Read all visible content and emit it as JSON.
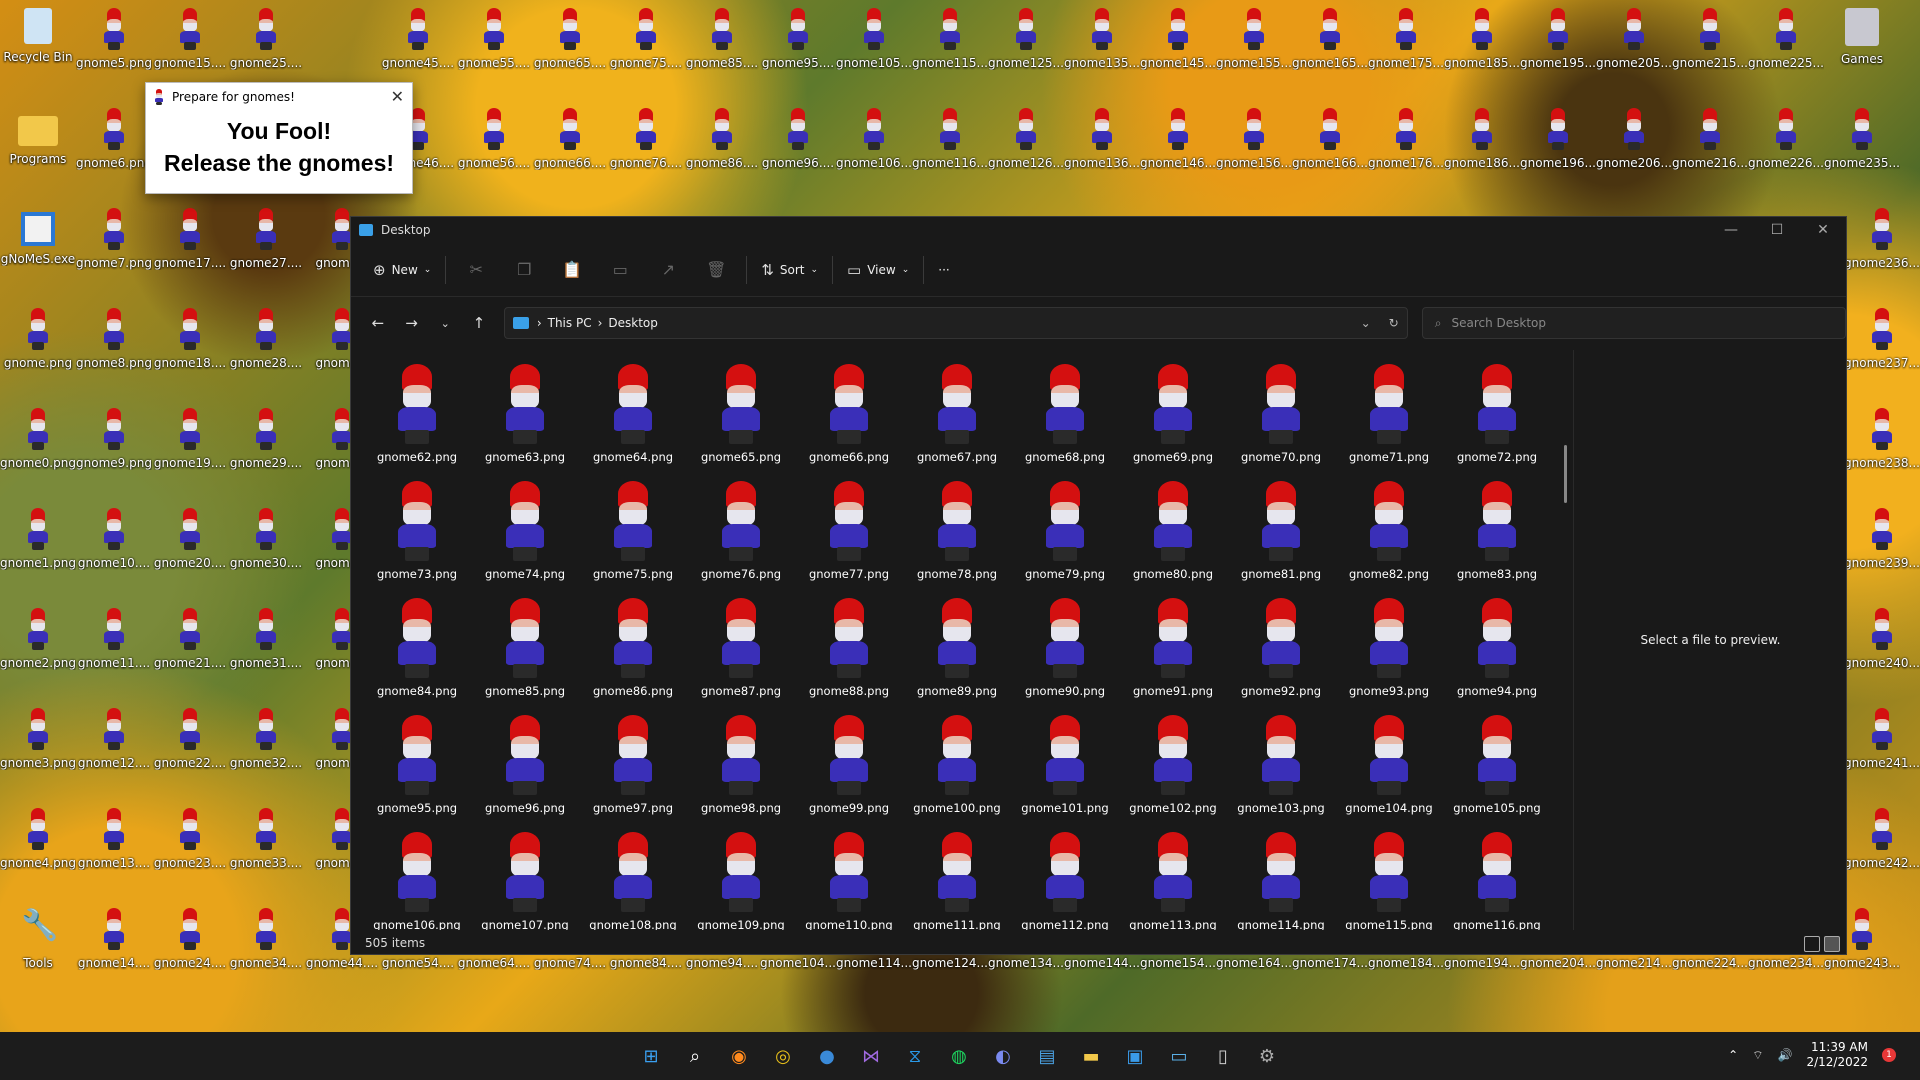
{
  "desktop": {
    "col0": [
      "Recycle Bin",
      "Programs",
      "gNoMeS.exe",
      "gnome.png",
      "gnome0.png",
      "gnome1.png",
      "gnome2.png",
      "gnome3.png",
      "gnome4.png",
      "Tools"
    ],
    "col1": [
      "gnome5.png",
      "gnome6.png",
      "gnome7.png",
      "gnome8.png",
      "gnome9.png",
      "gnome10....",
      "gnome11....",
      "gnome12....",
      "gnome13....",
      "gnome14...."
    ],
    "col2": [
      "gnome15....",
      "",
      "gnome17....",
      "gnome18....",
      "gnome19....",
      "gnome20....",
      "gnome21....",
      "gnome22....",
      "gnome23....",
      "gnome24...."
    ],
    "col3": [
      "gnome25....",
      "",
      "gnome27....",
      "gnome28....",
      "gnome29....",
      "gnome30....",
      "gnome31....",
      "gnome32....",
      "gnome33....",
      "gnome34...."
    ],
    "col4": [
      "gnome35....",
      "",
      "gnome...",
      "gnome...",
      "gnome...",
      "gnome...",
      "gnome...",
      "gnome...",
      "gnome...",
      "gnome44...."
    ],
    "row0": [
      "gnome45....",
      "gnome55....",
      "gnome65....",
      "gnome75....",
      "gnome85....",
      "gnome95....",
      "gnome105....",
      "gnome115....",
      "gnome125....",
      "gnome135....",
      "gnome145....",
      "gnome155....",
      "gnome165....",
      "gnome175....",
      "gnome185....",
      "gnome195....",
      "gnome205....",
      "gnome215....",
      "gnome225....",
      "Games"
    ],
    "row1": [
      "gnome46....",
      "gnome56....",
      "gnome66....",
      "gnome76....",
      "gnome86....",
      "gnome96....",
      "gnome106....",
      "gnome116....",
      "gnome126....",
      "gnome136....",
      "gnome146....",
      "gnome156....",
      "gnome166....",
      "gnome176....",
      "gnome186....",
      "gnome196....",
      "gnome206....",
      "gnome216....",
      "gnome226....",
      "gnome235...."
    ],
    "bottom": [
      "gnome54....",
      "gnome64....",
      "gnome74....",
      "gnome84....",
      "gnome94....",
      "gnome104....",
      "gnome114....",
      "gnome124....",
      "gnome134....",
      "gnome144....",
      "gnome154....",
      "gnome164....",
      "gnome174....",
      "gnome184....",
      "gnome194....",
      "gnome204....",
      "gnome214....",
      "gnome224....",
      "gnome234....",
      "gnome243...."
    ],
    "right": [
      "gnome236....",
      "gnome237....",
      "gnome238....",
      "gnome239....",
      "gnome240....",
      "gnome241....",
      "gnome242...."
    ]
  },
  "popup": {
    "title": "Prepare for gnomes!",
    "line1": "You Fool!",
    "line2": "Release the gnomes!",
    "close": "✕"
  },
  "explorer": {
    "title": "Desktop",
    "controls": {
      "minimize": "—",
      "maximize": "☐",
      "close": "✕"
    },
    "toolbar": {
      "new": "New",
      "sort": "Sort",
      "view": "View",
      "more": "···"
    },
    "address": {
      "crumbs": [
        "This PC",
        "Desktop"
      ]
    },
    "search_placeholder": "Search Desktop",
    "files": [
      "gnome62.png",
      "gnome63.png",
      "gnome64.png",
      "gnome65.png",
      "gnome66.png",
      "gnome67.png",
      "gnome68.png",
      "gnome69.png",
      "gnome70.png",
      "gnome71.png",
      "gnome72.png",
      "gnome73.png",
      "gnome74.png",
      "gnome75.png",
      "gnome76.png",
      "gnome77.png",
      "gnome78.png",
      "gnome79.png",
      "gnome80.png",
      "gnome81.png",
      "gnome82.png",
      "gnome83.png",
      "gnome84.png",
      "gnome85.png",
      "gnome86.png",
      "gnome87.png",
      "gnome88.png",
      "gnome89.png",
      "gnome90.png",
      "gnome91.png",
      "gnome92.png",
      "gnome93.png",
      "gnome94.png",
      "gnome95.png",
      "gnome96.png",
      "gnome97.png",
      "gnome98.png",
      "gnome99.png",
      "gnome100.png",
      "gnome101.png",
      "gnome102.png",
      "gnome103.png",
      "gnome104.png",
      "gnome105.png",
      "gnome106.png",
      "gnome107.png",
      "gnome108.png",
      "gnome109.png",
      "gnome110.png",
      "gnome111.png",
      "gnome112.png",
      "gnome113.png",
      "gnome114.png",
      "gnome115.png",
      "gnome116.png"
    ],
    "preview_text": "Select a file to preview.",
    "status": "505 items"
  },
  "taskbar": {
    "apps": [
      "start-icon",
      "search-icon",
      "firefox-icon",
      "chrome-icon",
      "app-icon",
      "visual-studio-icon",
      "vscode-icon",
      "spotify-icon",
      "discord-icon",
      "notepad-icon",
      "file-explorer-icon",
      "store-icon",
      "rdp-icon",
      "terminal-icon",
      "settings-icon"
    ],
    "time": "11:39 AM",
    "date": "2/12/2022",
    "notifications": "1"
  }
}
